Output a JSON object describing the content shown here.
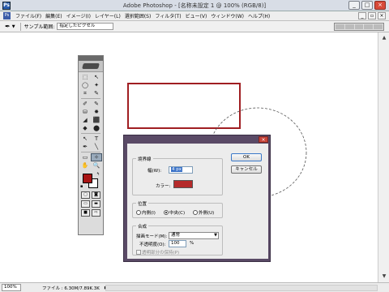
{
  "window": {
    "title": "Adobe Photoshop - [名称未設定 1 @ 100% (RGB/8)]",
    "app_icon": "Ps",
    "buttons": {
      "minimize": "_",
      "maximize": "□",
      "close": "×"
    }
  },
  "menubar": {
    "logo": "Ps",
    "items": [
      "ファイル(F)",
      "編集(E)",
      "イメージ(I)",
      "レイヤー(L)",
      "選択範囲(S)",
      "フィルタ(T)",
      "ビュー(V)",
      "ウィンドウ(W)",
      "ヘルプ(H)"
    ]
  },
  "options_bar": {
    "tool_icon": "eyedropper-icon",
    "sample_label": "サンプル範囲:",
    "sample_value": "指定したピクセル"
  },
  "status_bar": {
    "zoom": "100%",
    "info": "ファイル : 6.30M/7.89K.3K"
  },
  "toolbox": {
    "tools": [
      [
        "⬚",
        "↖"
      ],
      [
        "◯",
        "✦"
      ],
      [
        "⌗",
        "✎"
      ],
      [
        "✐",
        "✎"
      ],
      [
        "⛁",
        "✸"
      ],
      [
        "◢",
        "⬛"
      ],
      [
        "◆",
        "⬤"
      ],
      [
        "↖",
        "T"
      ],
      [
        "✒",
        "╲"
      ],
      [
        "▭",
        "✧"
      ],
      [
        "✋",
        "🔍"
      ]
    ],
    "foreground_color": "#a81414",
    "background_color": "#ffffff"
  },
  "dialog": {
    "stroke_group": "境界線",
    "width_label": "幅(W):",
    "width_value": "4 px",
    "color_label": "カラー:",
    "color_value": "#b52a2a",
    "position_group": "位置",
    "position_options": [
      "内側(I)",
      "中央(C)",
      "外側(U)"
    ],
    "position_selected": 1,
    "blend_group": "合成",
    "mode_label": "描画モード(M):",
    "mode_value": "通常",
    "opacity_label": "不透明度(O):",
    "opacity_value": "100",
    "opacity_unit": "%",
    "preserve_label": "透明部分の保持(P)",
    "ok_label": "OK",
    "cancel_label": "キャンセル"
  }
}
